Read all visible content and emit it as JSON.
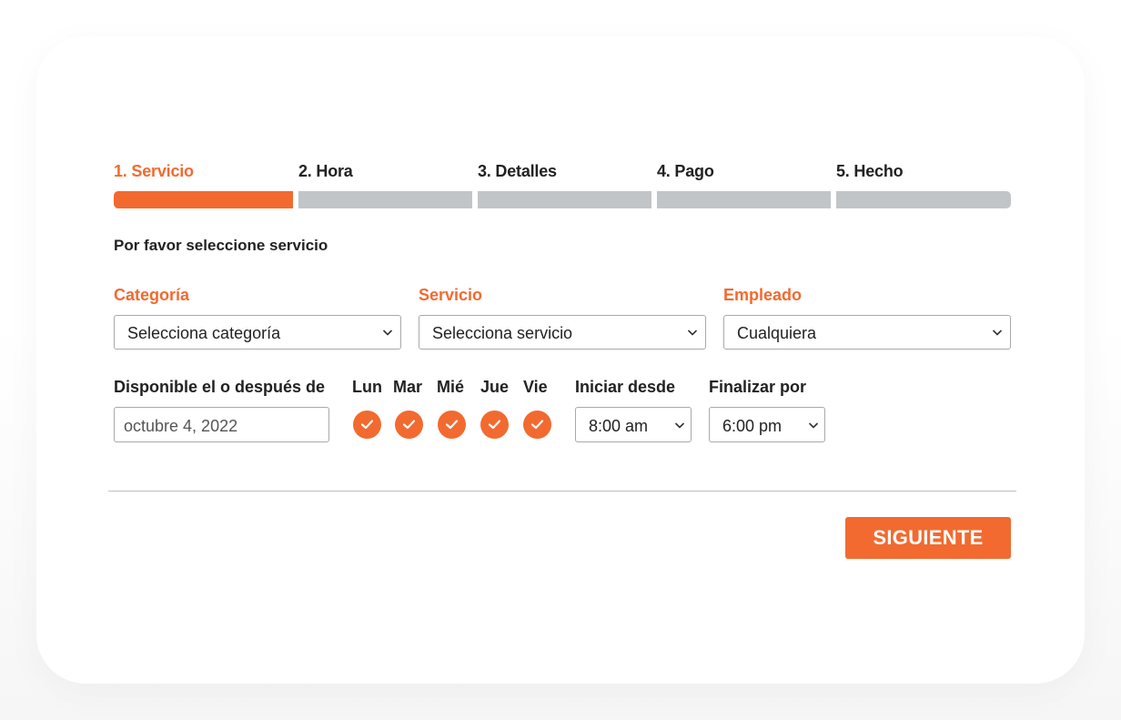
{
  "steps": [
    {
      "label": "1. Servicio",
      "active": true
    },
    {
      "label": "2. Hora",
      "active": false
    },
    {
      "label": "3. Detalles",
      "active": false
    },
    {
      "label": "4. Pago",
      "active": false
    },
    {
      "label": "5. Hecho",
      "active": false
    }
  ],
  "instruction": "Por favor seleccione servicio",
  "fields": {
    "category": {
      "label": "Categoría",
      "value": "Selecciona categoría"
    },
    "service": {
      "label": "Servicio",
      "value": "Selecciona servicio"
    },
    "employee": {
      "label": "Empleado",
      "value": "Cualquiera"
    }
  },
  "availability": {
    "date_label": "Disponible el o después de",
    "date_value": "octubre 4, 2022",
    "days": [
      {
        "label": "Lun",
        "checked": true
      },
      {
        "label": "Mar",
        "checked": true
      },
      {
        "label": "Mié",
        "checked": true
      },
      {
        "label": "Jue",
        "checked": true
      },
      {
        "label": "Vie",
        "checked": true
      }
    ],
    "start_label": "Iniciar desde",
    "start_value": "8:00 am",
    "end_label": "Finalizar por",
    "end_value": "6:00 pm"
  },
  "next_button": "SIGUIENTE",
  "colors": {
    "accent": "#f26a2f",
    "inactive_bar": "#c1c5c8",
    "text": "#222222"
  },
  "icons": {
    "select_arrow": "chevron-down-icon",
    "day_check": "check-icon"
  }
}
